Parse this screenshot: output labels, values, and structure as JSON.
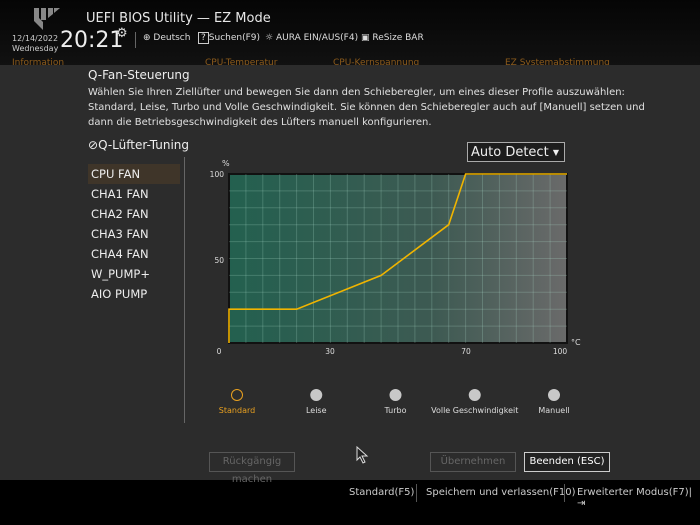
{
  "header": {
    "title": "UEFI BIOS Utility — EZ Mode",
    "date": "12/14/2022",
    "weekday": "Wednesday",
    "time": "20:21",
    "toolbar": [
      {
        "label": "Deutsch",
        "icon": "globe-icon"
      },
      {
        "label": "Suchen(F9)",
        "icon": "help-icon"
      },
      {
        "label": "AURA EIN/AUS(F4)",
        "icon": "aura-icon"
      },
      {
        "label": "ReSize BAR",
        "icon": "resize-bar-icon"
      }
    ]
  },
  "background_tabs": [
    "Information",
    "CPU-Temperatur",
    "CPU-Kernspannung",
    "EZ Systemabstimmung"
  ],
  "dialog": {
    "title": "Q-Fan-Steuerung",
    "description": "Wählen Sie Ihren Ziellüfter und bewegen Sie dann den Schieberegler, um eines dieser Profile auszuwählen: Standard, Leise, Turbo und Volle Geschwindigkeit. Sie können den Schieberegler auch auf [Manuell] setzen und dann die Betriebsgeschwindigkeit des Lüfters manuell konfigurieren.",
    "section": "Q-Lüfter-Tuning",
    "fans": [
      "CPU FAN",
      "CHA1 FAN",
      "CHA2 FAN",
      "CHA3 FAN",
      "CHA4 FAN",
      "W_PUMP+",
      "AIO PUMP"
    ],
    "selected_fan": "CPU FAN",
    "mode_select": "Auto Detect",
    "profiles": [
      "Standard",
      "Leise",
      "Turbo",
      "Volle Geschwindigkeit",
      "Manuell"
    ],
    "selected_profile": "Standard",
    "buttons": {
      "undo": "Rückgängig machen",
      "apply": "Übernehmen",
      "exit": "Beenden (ESC)"
    }
  },
  "chart_data": {
    "type": "line",
    "xlabel": "°C",
    "ylabel": "%",
    "xlim": [
      0,
      100
    ],
    "ylim": [
      0,
      100
    ],
    "xticks": [
      "0",
      "30",
      "70",
      "100"
    ],
    "yticks": [
      "50",
      "100"
    ],
    "x": [
      0,
      0,
      20,
      45,
      65,
      70,
      100
    ],
    "y": [
      0,
      20,
      20,
      40,
      70,
      100,
      100
    ],
    "line_color": "#f0b400",
    "grid": true
  },
  "footer": [
    "Standard(F5)",
    "Speichern und verlassen(F10)",
    "Erweiterter Modus(F7)"
  ],
  "colors": {
    "accent": "#f0b400",
    "profile_active": "#e8a020"
  }
}
